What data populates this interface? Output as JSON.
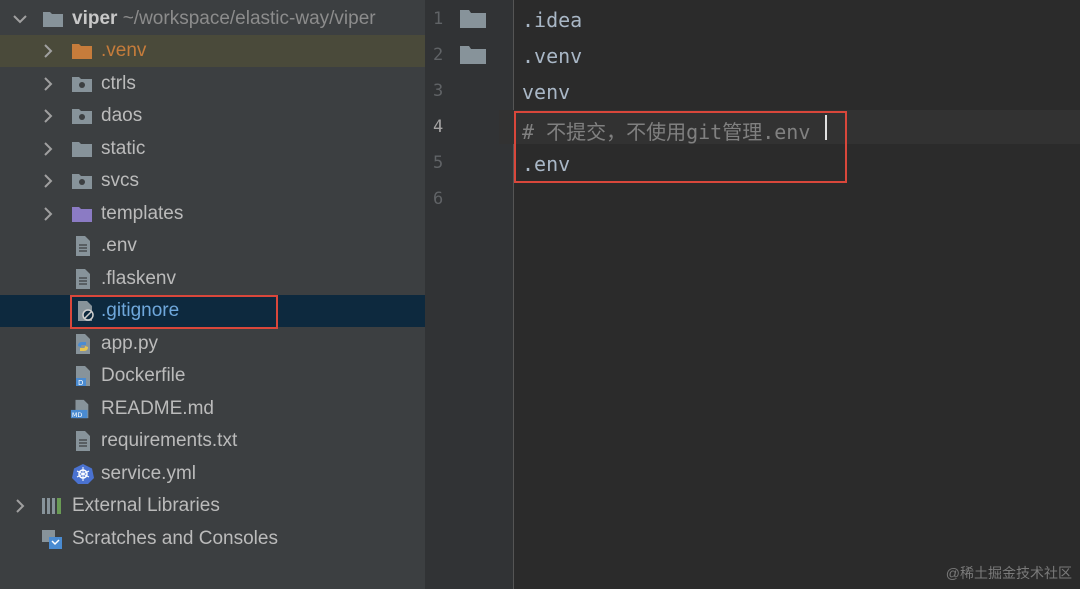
{
  "project": {
    "name": "viper",
    "path": "~/workspace/elastic-way/viper"
  },
  "tree": {
    "dirs": [
      {
        "label": ".venv",
        "icon": "excluded-folder-icon",
        "color": "#c67c3b"
      },
      {
        "label": "ctrls",
        "icon": "package-folder-icon",
        "color": "#bbbbbb"
      },
      {
        "label": "daos",
        "icon": "package-folder-icon",
        "color": "#bbbbbb"
      },
      {
        "label": "static",
        "icon": "folder-icon",
        "color": "#bbbbbb"
      },
      {
        "label": "svcs",
        "icon": "package-folder-icon",
        "color": "#bbbbbb"
      },
      {
        "label": "templates",
        "icon": "templates-folder-icon",
        "color": "#bbbbbb"
      }
    ],
    "files": [
      {
        "label": ".env",
        "icon": "text-file-icon"
      },
      {
        "label": ".flaskenv",
        "icon": "text-file-icon"
      },
      {
        "label": ".gitignore",
        "icon": "ignore-file-icon"
      },
      {
        "label": "app.py",
        "icon": "python-file-icon"
      },
      {
        "label": "Dockerfile",
        "icon": "docker-file-icon"
      },
      {
        "label": "README.md",
        "icon": "markdown-file-icon"
      },
      {
        "label": "requirements.txt",
        "icon": "text-file-icon"
      },
      {
        "label": "service.yml",
        "icon": "kubernetes-file-icon"
      }
    ],
    "external_libraries": "External Libraries",
    "scratches": "Scratches and Consoles"
  },
  "editor": {
    "line_numbers": [
      "1",
      "2",
      "3",
      "4",
      "5",
      "6"
    ],
    "lines": [
      ".idea",
      ".venv",
      "venv",
      "# 不提交，不使用git管理.env",
      ".env",
      ""
    ],
    "active_line": 4
  },
  "colors": {
    "selection": "#0d293e",
    "highlight_box": "#d9473b",
    "excluded": "#c67c3b"
  },
  "watermark": "@稀土掘金技术社区"
}
